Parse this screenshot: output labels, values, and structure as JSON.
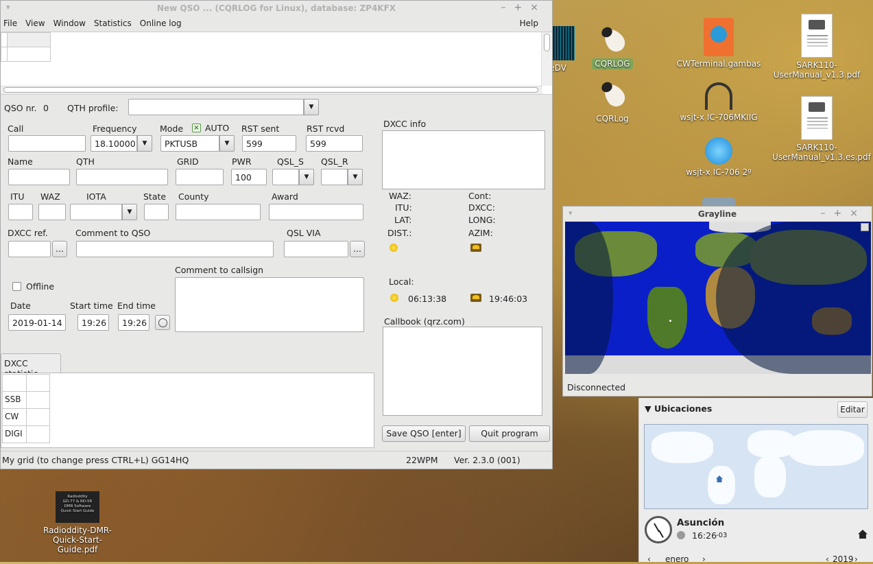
{
  "desktop": {
    "icons": [
      {
        "label": "eeDV"
      },
      {
        "label": "CQRLOG"
      },
      {
        "label": "CQRLog"
      },
      {
        "label": "CWTerminal.gambas"
      },
      {
        "label": "wsjt-x IC-706MKIIG"
      },
      {
        "label": "wsjt-x IC-706 2º"
      },
      {
        "label": "SARK110-UserManual_v1.3.pdf"
      },
      {
        "label": "SARK110-UserManual_v1.3.es.pdf"
      },
      {
        "label": "Radioddity-DMR-Quick-Start-Guide.pdf"
      }
    ],
    "thumb_text": {
      "l1": "Radioddity",
      "l2": "GD-77 & RD-5R",
      "l3": "DMR Software",
      "l4": "Quick Start Guide"
    }
  },
  "main_window": {
    "title": "New QSO ... (CQRLOG for Linux), database: ZP4KFX",
    "menu": [
      "File",
      "View",
      "Window",
      "Statistics",
      "Online log"
    ],
    "help": "Help",
    "qso_nr_label": "QSO nr.",
    "qso_nr_value": "0",
    "qth_profile_label": "QTH profile:",
    "qth_profile_value": "",
    "labels": {
      "call": "Call",
      "frequency": "Frequency",
      "mode": "Mode",
      "auto": "AUTO",
      "rst_sent": "RST sent",
      "rst_rcvd": "RST rcvd",
      "name": "Name",
      "qth": "QTH",
      "grid": "GRID",
      "pwr": "PWR",
      "qsl_s": "QSL_S",
      "qsl_r": "QSL_R",
      "itu": "ITU",
      "waz": "WAZ",
      "iota": "IOTA",
      "state": "State",
      "county": "County",
      "award": "Award",
      "dxcc_ref": "DXCC ref.",
      "comment_qso": "Comment to QSO",
      "qsl_via": "QSL VIA",
      "comment_callsign": "Comment to callsign",
      "offline": "Offline",
      "date": "Date",
      "start_time": "Start time",
      "end_time": "End time"
    },
    "values": {
      "call": "",
      "frequency": "18.10000",
      "mode": "PKTUSB",
      "rst_sent": "599",
      "rst_rcvd": "599",
      "name": "",
      "qth": "",
      "grid": "",
      "pwr": "100",
      "date": "2019-01-14",
      "start_time": "19:26",
      "end_time": "19:26"
    },
    "ellipsis": "...",
    "dxcc_info": {
      "title": "DXCC info",
      "waz": "WAZ:",
      "cont": "Cont:",
      "itu": "ITU:",
      "dxcc": "DXCC:",
      "lat": "LAT:",
      "long": "LONG:",
      "dist": "DIST.:",
      "azim": "AZIM:",
      "local": "Local:",
      "sunrise": "06:13:38",
      "sunset": "19:46:03"
    },
    "callbook_title": "Callbook (qrz.com)",
    "save_btn": "Save QSO [enter]",
    "quit_btn": "Quit program",
    "stat_tab": "DXCC statistic",
    "stat_rows": [
      "SSB",
      "CW",
      "DIGI"
    ],
    "status_grid": "My grid (to change press CTRL+L) GG14HQ",
    "status_wpm": "22WPM",
    "status_ver": "Ver. 2.3.0 (001)"
  },
  "grayline": {
    "title": "Grayline",
    "status": "Disconnected"
  },
  "weather": {
    "header": "Ubicaciones",
    "edit": "Editar",
    "city": "Asunción",
    "time": "16:26",
    "offset": "-03",
    "month": "enero",
    "year": "2019"
  }
}
